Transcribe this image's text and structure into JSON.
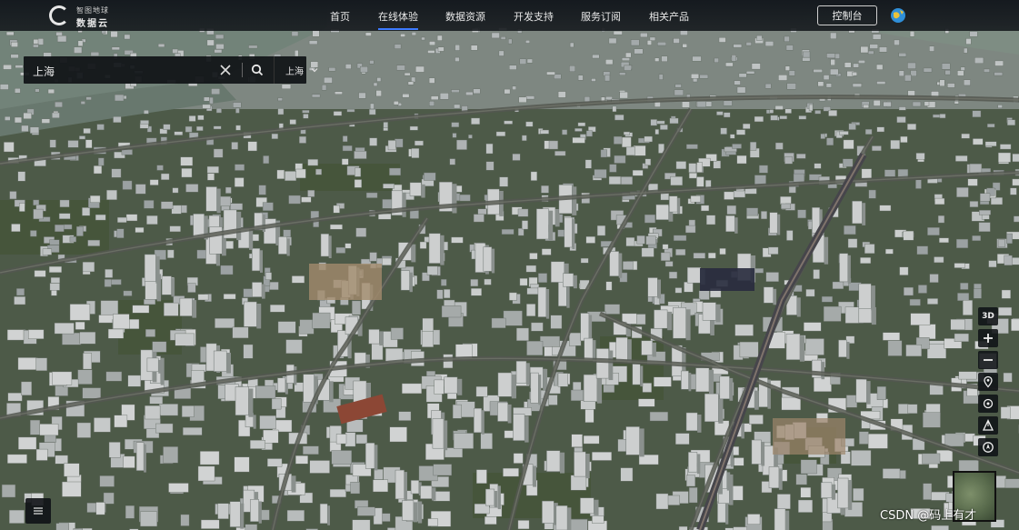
{
  "header": {
    "logo_line1": "智图地球",
    "logo_line2": "数据云",
    "nav": [
      {
        "label": "首页",
        "active": false
      },
      {
        "label": "在线体验",
        "active": true
      },
      {
        "label": "数据资源",
        "active": false
      },
      {
        "label": "开发支持",
        "active": false
      },
      {
        "label": "服务订阅",
        "active": false
      },
      {
        "label": "相关产品",
        "active": false
      }
    ],
    "console_label": "控制台"
  },
  "search": {
    "value": "上海",
    "city": "上海"
  },
  "controls": {
    "mode_label": "3D"
  },
  "watermark": "CSDN @码上有才",
  "colors": {
    "accent": "#3d7bff",
    "river": "#7f9187",
    "vegetation": "#4c5d3e"
  }
}
